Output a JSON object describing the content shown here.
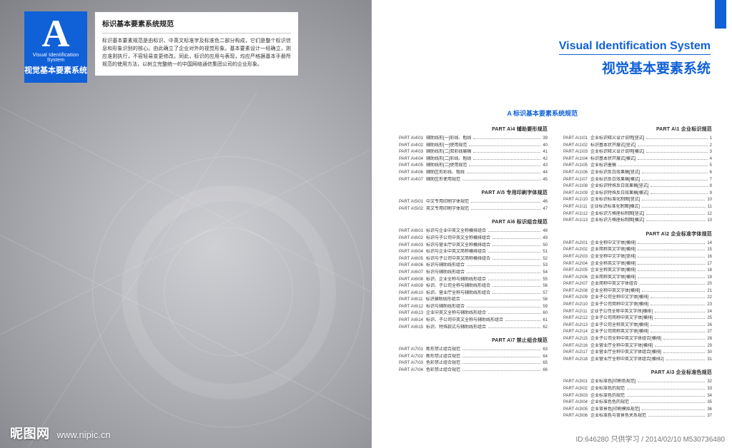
{
  "colors": {
    "accent": "#1060d8"
  },
  "left": {
    "badge": {
      "letter": "A",
      "en": "Visual Identification System",
      "cn": "视觉基本要素系统"
    },
    "desc": {
      "title": "标识基本要素系统规范",
      "body": "标识基本要素规范是由标识、中英文标准字及标准色二部分构成，它们是整个标识信息和形象识别的核心。由此确立了企业对外的视觉形象。基本要素设计一经确立，则应准则执行，不容轻易变更修改。同此，标识的应用与表现，均应严格据基本手册所规范的使用方法，以树立完整统一的中国网络通信集团公司的企业形象。"
    },
    "footer": {
      "brand": "昵图网",
      "url": "www.nipic.cn"
    }
  },
  "right": {
    "header": {
      "en": "Visual Identification System",
      "cn": "视觉基本要素系统"
    },
    "tocTitle": "A  标识基本要素系统规范",
    "footer": "ID:646280  只供学习 / 2014/02/10 M530736480",
    "sectionsCol1": [
      {
        "head": "PART A\\1  企业标识规范",
        "rows": [
          {
            "c": "PART A\\1\\01",
            "l": "企业标识释义设计说明[竖式]",
            "p": "1"
          },
          {
            "c": "PART A\\1\\02",
            "l": "标识基本状开展式[竖式]",
            "p": "2"
          },
          {
            "c": "PART A\\1\\03",
            "l": "企业标识释义设计说明[横式]",
            "p": "3"
          },
          {
            "c": "PART A\\1\\04",
            "l": "标识基本状开展式[横式]",
            "p": "4"
          },
          {
            "c": "PART A\\1\\05",
            "l": "企业标识墨稿",
            "p": "5"
          },
          {
            "c": "PART A\\1\\06",
            "l": "企业标识反白效果稿[竖式]",
            "p": "6"
          },
          {
            "c": "PART A\\1\\07",
            "l": "企业标识反白效果稿[横式]",
            "p": "7"
          },
          {
            "c": "PART A\\1\\08",
            "l": "企业标识特殊反白效果稿[竖式]",
            "p": "8"
          },
          {
            "c": "PART A\\1\\09",
            "l": "企业标识特殊反白效果稿[横式]",
            "p": "9"
          },
          {
            "c": "PART A\\1\\10",
            "l": "企业标识标准化制图[竖式]",
            "p": "10"
          },
          {
            "c": "PART A\\1\\11",
            "l": "企业标识标准化制图[横式]",
            "p": "11"
          },
          {
            "c": "PART A\\1\\12",
            "l": "企业标识方格座标制图[竖式]",
            "p": "12"
          },
          {
            "c": "PART A\\1\\13",
            "l": "企业标识方格座标制图[横式]",
            "p": "13"
          }
        ]
      },
      {
        "head": "PART A\\2  企业标准字体规范",
        "rows": [
          {
            "c": "PART A\\2\\01",
            "l": "企业全称中文字体[横排]",
            "p": "14"
          },
          {
            "c": "PART A\\2\\02",
            "l": "企业简称英文字体[横排]",
            "p": "15"
          },
          {
            "c": "PART A\\2\\03",
            "l": "企业全称中文字体[竖排]",
            "p": "16"
          },
          {
            "c": "PART A\\2\\04",
            "l": "企业全称英文字体[横排]",
            "p": "17"
          },
          {
            "c": "PART A\\2\\05",
            "l": "企业全称英文字体[横排]",
            "p": "18"
          },
          {
            "c": "PART A\\2\\06",
            "l": "企业简称英文字体[横排]",
            "p": "19"
          },
          {
            "c": "PART A\\2\\07",
            "l": "企业简称中英文字体组合",
            "p": "20"
          },
          {
            "c": "PART A\\2\\08",
            "l": "企业全称中英文字体[横排]",
            "p": "21"
          },
          {
            "c": "PART A\\2\\09",
            "l": "企业子公司全称中文字体[横排]",
            "p": "22"
          },
          {
            "c": "PART A\\2\\10",
            "l": "企业子公司简称中文字体[横排]",
            "p": "23"
          },
          {
            "c": "PART A\\2\\11",
            "l": "企业子公司全称中英文字体[横排]",
            "p": "24"
          },
          {
            "c": "PART A\\2\\12",
            "l": "企业子公司简称中英文字体[横排]",
            "p": "25"
          },
          {
            "c": "PART A\\2\\13",
            "l": "企业子公司全称英文字体[横排]",
            "p": "26"
          },
          {
            "c": "PART A\\2\\14",
            "l": "企业子公司简称英文字体[横排]",
            "p": "27"
          },
          {
            "c": "PART A\\2\\15",
            "l": "企业子公司全称中英文字体组合[横排]",
            "p": "28"
          },
          {
            "c": "PART A\\2\\16",
            "l": "企业营业厅全称中英文字体[横排]",
            "p": "29"
          },
          {
            "c": "PART A\\2\\17",
            "l": "企业营业厅全称中英文字体组合[横排]",
            "p": "30"
          },
          {
            "c": "PART A\\2\\18",
            "l": "企业营业厅全称中英文字体组合[横排2]",
            "p": "31"
          }
        ]
      },
      {
        "head": "PART A\\3  企业标准色规范",
        "rows": [
          {
            "c": "PART A\\3\\01",
            "l": "企业标准色[印刷色规范]",
            "p": "32"
          },
          {
            "c": "PART A\\3\\02",
            "l": "企业标准色的规范",
            "p": "33"
          },
          {
            "c": "PART A\\3\\03",
            "l": "企业标准色的规范",
            "p": "34"
          },
          {
            "c": "PART A\\3\\04",
            "l": "企业标准色色的规范",
            "p": "35"
          },
          {
            "c": "PART A\\3\\05",
            "l": "企业背景色[印刷模拟规范]",
            "p": "36"
          },
          {
            "c": "PART A\\3\\06",
            "l": "企业标准色与背景色关系规范",
            "p": "37"
          }
        ]
      }
    ],
    "sectionsCol2": [
      {
        "head": "PART A\\4  辅助要形规范",
        "rows": [
          {
            "c": "PART A\\4\\01",
            "l": "辅助线形[一]彩线、粗线",
            "p": "39"
          },
          {
            "c": "PART A\\4\\02",
            "l": "辅助线形[一]使用规范",
            "p": "40"
          },
          {
            "c": "PART A\\4\\03",
            "l": "辅助线形[二]双彩线展稿",
            "p": "41"
          },
          {
            "c": "PART A\\4\\04",
            "l": "辅助线形[二]彩线、粗线",
            "p": "42"
          },
          {
            "c": "PART A\\4\\05",
            "l": "辅助线形[二]使用规范",
            "p": "43"
          },
          {
            "c": "PART A\\4\\06",
            "l": "辅助区形彩线、粗线",
            "p": "44"
          },
          {
            "c": "PART A\\4\\07",
            "l": "辅助区形使用规范",
            "p": "45"
          }
        ]
      },
      {
        "head": "PART A\\5  专用印刷字体规范",
        "rows": [
          {
            "c": "PART A\\5\\01",
            "l": "中文专用印刷字体规范",
            "p": "46"
          },
          {
            "c": "PART A\\5\\02",
            "l": "英文专用印刷字体规范",
            "p": "47"
          }
        ]
      },
      {
        "head": "PART A\\6  标识组合规范",
        "rows": [
          {
            "c": "PART A\\6\\01",
            "l": "标识与企业中英文全称横排组合",
            "p": "48"
          },
          {
            "c": "PART A\\6\\02",
            "l": "标识与子公司中英文全称横排组合",
            "p": "49"
          },
          {
            "c": "PART A\\6\\03",
            "l": "标识与营业厅中英文全称横排组合",
            "p": "50"
          },
          {
            "c": "PART A\\6\\04",
            "l": "标识与企业中英文简称横排组合",
            "p": "51"
          },
          {
            "c": "PART A\\6\\05",
            "l": "标识与子公司中英文简称横排组合",
            "p": "52"
          },
          {
            "c": "PART A\\6\\06",
            "l": "标识与辅助线形组合",
            "p": "53"
          },
          {
            "c": "PART A\\6\\07",
            "l": "标识与辅助线形组合",
            "p": "54"
          },
          {
            "c": "PART A\\6\\08",
            "l": "标识、企业全称与辅助线形组合",
            "p": "55"
          },
          {
            "c": "PART A\\6\\09",
            "l": "标识、子公司全称与辅助线形组合",
            "p": "56"
          },
          {
            "c": "PART A\\6\\10",
            "l": "标识、营业厅全称与辅助线形组合",
            "p": "57"
          },
          {
            "c": "PART A\\6\\11",
            "l": "标识辅助线形组合",
            "p": "58"
          },
          {
            "c": "PART A\\6\\12",
            "l": "标识与辅助线形组合",
            "p": "59"
          },
          {
            "c": "PART A\\6\\13",
            "l": "企业中英文全称与辅助线形组合",
            "p": "60"
          },
          {
            "c": "PART A\\6\\14",
            "l": "标识、子公司中英文全称与辅助线形组合",
            "p": "61"
          },
          {
            "c": "PART A\\6\\15",
            "l": "标识、特殊款式与辅助线形组合",
            "p": "62"
          }
        ]
      },
      {
        "head": "PART A\\7  禁止组合规范",
        "rows": [
          {
            "c": "PART A\\7\\01",
            "l": "断形禁止组合规范",
            "p": "63"
          },
          {
            "c": "PART A\\7\\02",
            "l": "断形禁止组合规范",
            "p": "64"
          },
          {
            "c": "PART A\\7\\03",
            "l": "色彩禁止组合规范",
            "p": "65"
          },
          {
            "c": "PART A\\7\\04",
            "l": "色彩禁止组合规范",
            "p": "66"
          }
        ]
      }
    ]
  }
}
